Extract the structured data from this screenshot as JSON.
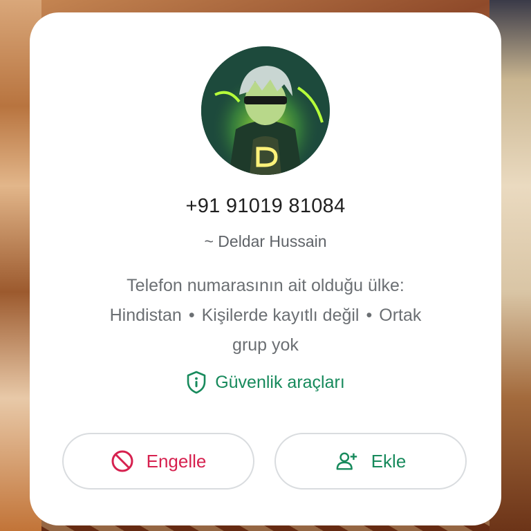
{
  "contact": {
    "phone": "+91 91019 81084",
    "push_name": "~ Deldar Hussain",
    "avatar_letter": "D",
    "info_line1": "Telefon numarasının ait olduğu ülke:",
    "country": "Hindistan",
    "saved_status": "Kişilerde kayıtlı değil",
    "groups_prefix": "Ortak",
    "groups_suffix": "grup yok",
    "separator": "•"
  },
  "safety": {
    "label": "Güvenlik araçları",
    "icon": "shield-info-icon"
  },
  "actions": {
    "block_label": "Engelle",
    "block_icon": "block-icon",
    "add_label": "Ekle",
    "add_icon": "add-person-icon"
  },
  "colors": {
    "accent_green": "#178a5c",
    "danger_red": "#d6214f",
    "primary_text": "#1f1f1f",
    "secondary_text": "#6b6f73"
  }
}
